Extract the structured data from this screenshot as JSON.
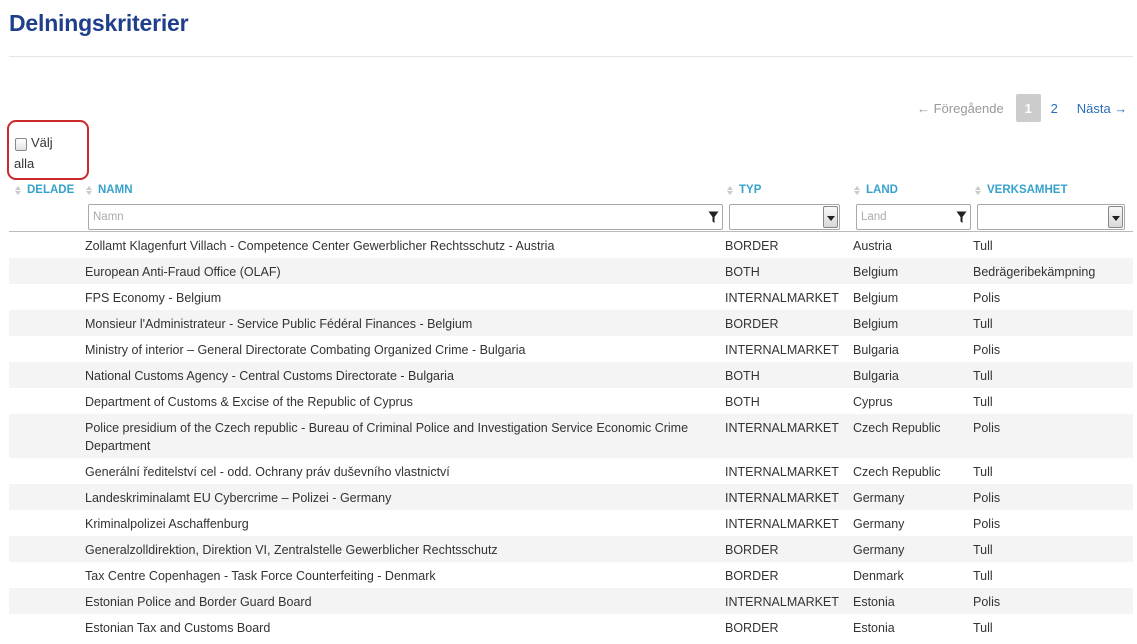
{
  "page": {
    "title": "Delningskriterier"
  },
  "pagination": {
    "prev": "← Föregående",
    "pages": [
      "1",
      "2"
    ],
    "next": "Nästa →"
  },
  "select_all": {
    "label_line1": "Välj",
    "label_line2": "alla"
  },
  "columns": {
    "delade": "DELADE",
    "namn": "NAMN",
    "typ": "TYP",
    "land": "LAND",
    "verksamhet": "VERKSAMHET"
  },
  "filters": {
    "namn_placeholder": "Namn",
    "land_placeholder": "Land"
  },
  "rows": [
    {
      "name": "Zollamt Klagenfurt Villach - Competence Center Gewerblicher Rechtsschutz - Austria",
      "type": "BORDER",
      "country": "Austria",
      "activity": "Tull"
    },
    {
      "name": "European Anti-Fraud Office (OLAF)",
      "type": "BOTH",
      "country": "Belgium",
      "activity": "Bedrägeribekämpning"
    },
    {
      "name": "FPS Economy - Belgium",
      "type": "INTERNALMARKET",
      "country": "Belgium",
      "activity": "Polis"
    },
    {
      "name": "Monsieur l'Administrateur - Service Public Fédéral Finances - Belgium",
      "type": "BORDER",
      "country": "Belgium",
      "activity": "Tull"
    },
    {
      "name": "Ministry of interior – General Directorate Combating Organized Crime - Bulgaria",
      "type": "INTERNALMARKET",
      "country": "Bulgaria",
      "activity": "Polis"
    },
    {
      "name": "National Customs Agency - Central Customs Directorate - Bulgaria",
      "type": "BOTH",
      "country": "Bulgaria",
      "activity": "Tull"
    },
    {
      "name": "Department of Customs & Excise of the Republic of Cyprus",
      "type": "BOTH",
      "country": "Cyprus",
      "activity": "Tull"
    },
    {
      "name": "Police presidium of the Czech republic - Bureau of Criminal Police and Investigation Service Economic Crime Department",
      "type": "INTERNALMARKET",
      "country": "Czech Republic",
      "activity": "Polis"
    },
    {
      "name": "Generální ředitelství cel - odd. Ochrany práv duševního vlastnictví",
      "type": "INTERNALMARKET",
      "country": "Czech Republic",
      "activity": "Tull"
    },
    {
      "name": "Landeskriminalamt EU Cybercrime – Polizei - Germany",
      "type": "INTERNALMARKET",
      "country": "Germany",
      "activity": "Polis"
    },
    {
      "name": "Kriminalpolizei Aschaffenburg",
      "type": "INTERNALMARKET",
      "country": "Germany",
      "activity": "Polis"
    },
    {
      "name": "Generalzolldirektion, Direktion VI, Zentralstelle Gewerblicher Rechtsschutz",
      "type": "BORDER",
      "country": "Germany",
      "activity": "Tull"
    },
    {
      "name": "Tax Centre Copenhagen - Task Force Counterfeiting - Denmark",
      "type": "BORDER",
      "country": "Denmark",
      "activity": "Tull"
    },
    {
      "name": "Estonian Police and Border Guard Board",
      "type": "INTERNALMARKET",
      "country": "Estonia",
      "activity": "Polis"
    },
    {
      "name": "Estonian Tax and Customs Board",
      "type": "BORDER",
      "country": "Estonia",
      "activity": "Tull"
    }
  ]
}
